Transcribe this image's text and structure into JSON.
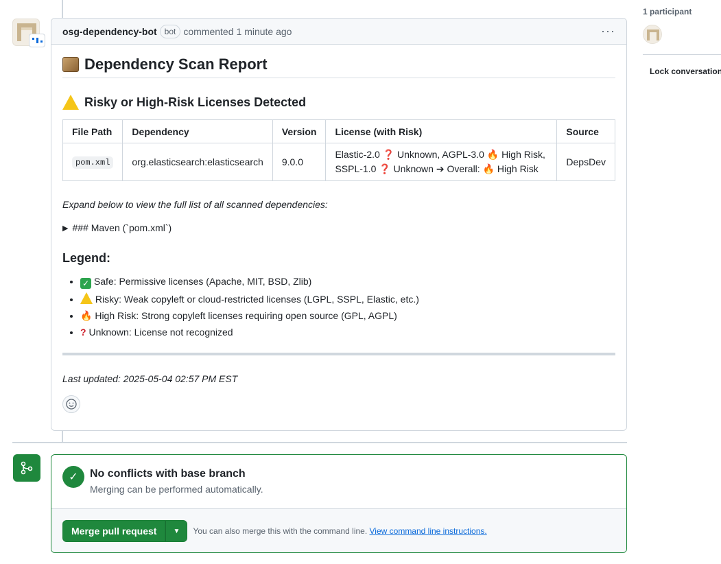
{
  "comment": {
    "author": "osg-dependency-bot",
    "badge": "bot",
    "action": "commented",
    "time": "1 minute ago",
    "more_icon": "kebab-horizontal-icon"
  },
  "report": {
    "title": "Dependency Scan Report",
    "subtitle": "Risky or High-Risk Licenses Detected",
    "table": {
      "headers": [
        "File Path",
        "Dependency",
        "Version",
        "License (with Risk)",
        "Source"
      ],
      "rows": [
        {
          "file_path": "pom.xml",
          "dependency": "org.elasticsearch:elasticsearch",
          "version": "9.0.0",
          "license": "Elastic-2.0 ❓ Unknown, AGPL-3.0 🔥 High Risk, SSPL-1.0 ❓ Unknown ➔ Overall: 🔥 High Risk",
          "source": "DepsDev"
        }
      ]
    },
    "expand_note": "Expand below to view the full list of all scanned dependencies:",
    "details_summary": "### Maven (`pom.xml`)",
    "legend_title": "Legend:",
    "legend": [
      {
        "icon": "check-icon",
        "text": "Safe: Permissive licenses (Apache, MIT, BSD, Zlib)"
      },
      {
        "icon": "warning-icon",
        "text": "Risky: Weak copyleft or cloud-restricted licenses (LGPL, SSPL, Elastic, etc.)"
      },
      {
        "icon": "fire-icon",
        "text": "High Risk: Strong copyleft licenses requiring open source (GPL, AGPL)"
      },
      {
        "icon": "question-icon",
        "text": "Unknown: License not recognized"
      }
    ],
    "last_updated": "Last updated: 2025-05-04 02:57 PM EST"
  },
  "sidebar": {
    "participants": "1 participant",
    "lock": "Lock conversation"
  },
  "merge": {
    "title": "No conflicts with base branch",
    "subtitle": "Merging can be performed automatically.",
    "button": "Merge pull request",
    "hint": "You can also merge this with the command line.",
    "link": "View command line instructions."
  },
  "colors": {
    "accent_green": "#1f883d",
    "link_blue": "#0969da",
    "border": "#d0d7de"
  }
}
